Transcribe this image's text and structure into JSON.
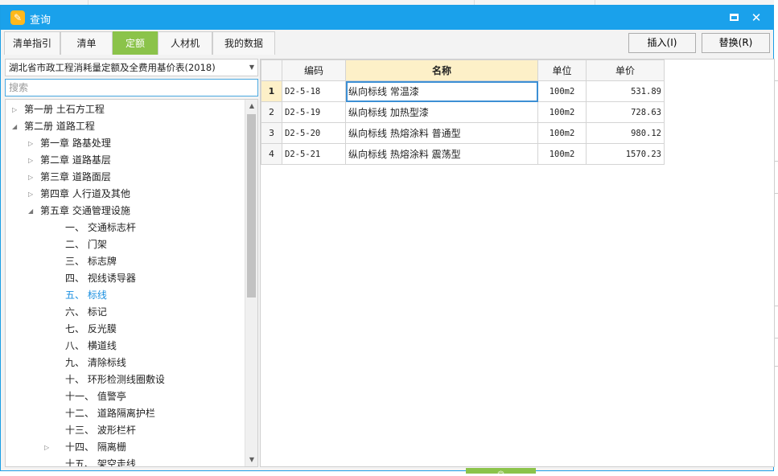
{
  "window": {
    "title": "查询",
    "icon": "pencil-note-icon"
  },
  "tabs": [
    {
      "label": "清单指引",
      "active": false
    },
    {
      "label": "清单",
      "active": false
    },
    {
      "label": "定额",
      "active": true
    },
    {
      "label": "人材机",
      "active": false
    },
    {
      "label": "我的数据",
      "active": false
    }
  ],
  "toolbar": {
    "insert_label": "插入(I)",
    "replace_label": "替换(R)"
  },
  "library": {
    "selected": "湖北省市政工程消耗量定额及全费用基价表(2018)"
  },
  "search": {
    "placeholder": "搜索",
    "value": ""
  },
  "tree": [
    {
      "label": "第一册 土石方工程",
      "level": 0,
      "toggle": "collapsed"
    },
    {
      "label": "第二册 道路工程",
      "level": 0,
      "toggle": "expanded"
    },
    {
      "label": "第一章 路基处理",
      "level": 1,
      "toggle": "collapsed"
    },
    {
      "label": "第二章 道路基层",
      "level": 1,
      "toggle": "collapsed"
    },
    {
      "label": "第三章 道路面层",
      "level": 1,
      "toggle": "collapsed"
    },
    {
      "label": "第四章 人行道及其他",
      "level": 1,
      "toggle": "collapsed"
    },
    {
      "label": "第五章 交通管理设施",
      "level": 1,
      "toggle": "expanded"
    },
    {
      "label": "一、 交通标志杆",
      "level": 2,
      "toggle": "none"
    },
    {
      "label": "二、 门架",
      "level": 2,
      "toggle": "none"
    },
    {
      "label": "三、 标志牌",
      "level": 2,
      "toggle": "none"
    },
    {
      "label": "四、 视线诱导器",
      "level": 2,
      "toggle": "none"
    },
    {
      "label": "五、 标线",
      "level": 2,
      "toggle": "none",
      "selected": true
    },
    {
      "label": "六、 标记",
      "level": 2,
      "toggle": "none"
    },
    {
      "label": "七、 反光膜",
      "level": 2,
      "toggle": "none"
    },
    {
      "label": "八、 横道线",
      "level": 2,
      "toggle": "none"
    },
    {
      "label": "九、 清除标线",
      "level": 2,
      "toggle": "none"
    },
    {
      "label": "十、 环形检测线圈敷设",
      "level": 2,
      "toggle": "none"
    },
    {
      "label": "十一、 值警亭",
      "level": 2,
      "toggle": "none"
    },
    {
      "label": "十二、 道路隔离护栏",
      "level": 2,
      "toggle": "none"
    },
    {
      "label": "十三、 波形栏杆",
      "level": 2,
      "toggle": "none"
    },
    {
      "label": "十四、 隔离栅",
      "level": 2,
      "toggle": "collapsed"
    },
    {
      "label": "十五、 架空走线",
      "level": 2,
      "toggle": "none"
    }
  ],
  "grid": {
    "columns": [
      "编码",
      "名称",
      "单位",
      "单价"
    ],
    "rows": [
      {
        "num": "1",
        "code": "D2-5-18",
        "name": "纵向标线 常温漆",
        "unit": "100m2",
        "price": "531.89"
      },
      {
        "num": "2",
        "code": "D2-5-19",
        "name": "纵向标线 加热型漆",
        "unit": "100m2",
        "price": "728.63"
      },
      {
        "num": "3",
        "code": "D2-5-20",
        "name": "纵向标线 热熔涂料 普通型",
        "unit": "100m2",
        "price": "980.12"
      },
      {
        "num": "4",
        "code": "D2-5-21",
        "name": "纵向标线 热熔涂料 震荡型",
        "unit": "100m2",
        "price": "1570.23"
      }
    ]
  },
  "colors": {
    "titlebar": "#1aa1eb",
    "active_tab": "#8bc34a",
    "selected_tree_text": "#1a8fe0",
    "header_highlight": "#fdf0c8"
  }
}
